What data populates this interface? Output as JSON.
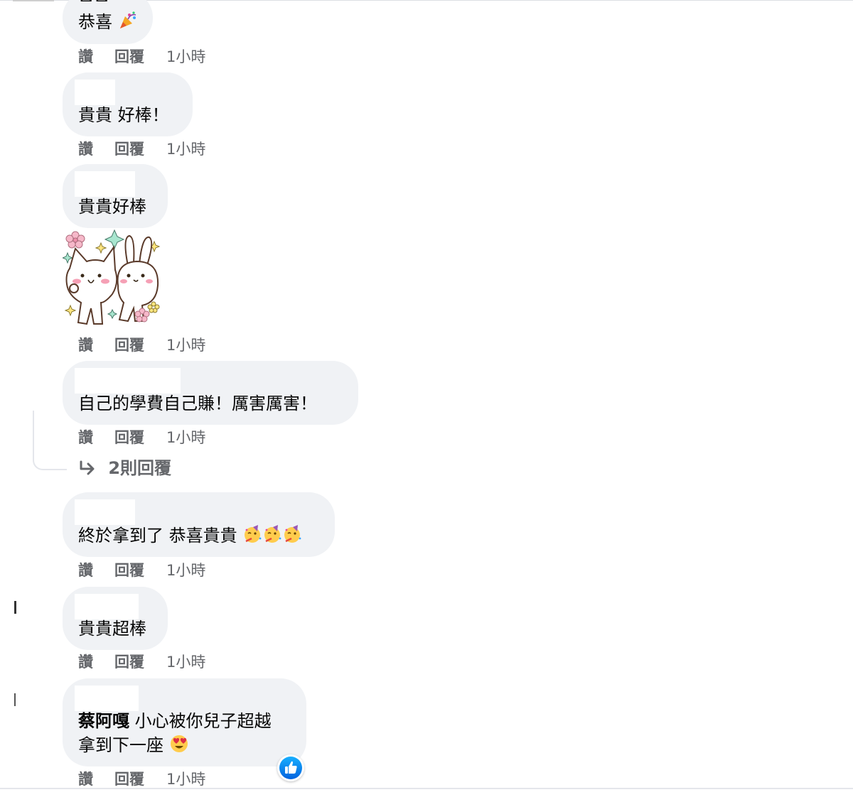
{
  "actions": {
    "like": "讚",
    "reply": "回覆",
    "time": "1小時"
  },
  "comments": [
    {
      "name": "貴貴",
      "text": "恭喜"
    },
    {
      "text": "貴貴 好棒！"
    },
    {
      "text": "貴貴好棒"
    },
    {
      "text": "自己的學費自己賺！厲害厲害！",
      "replies_label": "2則回覆"
    },
    {
      "text": "終於拿到了 恭喜貴貴"
    },
    {
      "text": "貴貴超棒"
    },
    {
      "mention": "蔡阿嘎",
      "text_line1": "小心被你兒子超越",
      "text_line2": "拿到下一座",
      "reaction": "like"
    }
  ],
  "icons": [
    "party-popper-icon",
    "partying-face-icon",
    "heart-eyes-icon",
    "reply-arrow-icon",
    "like-reaction-icon"
  ],
  "colors": {
    "bubble": "#f0f2f5",
    "secondary_text": "#65676b",
    "like_blue": "#1877f2"
  }
}
